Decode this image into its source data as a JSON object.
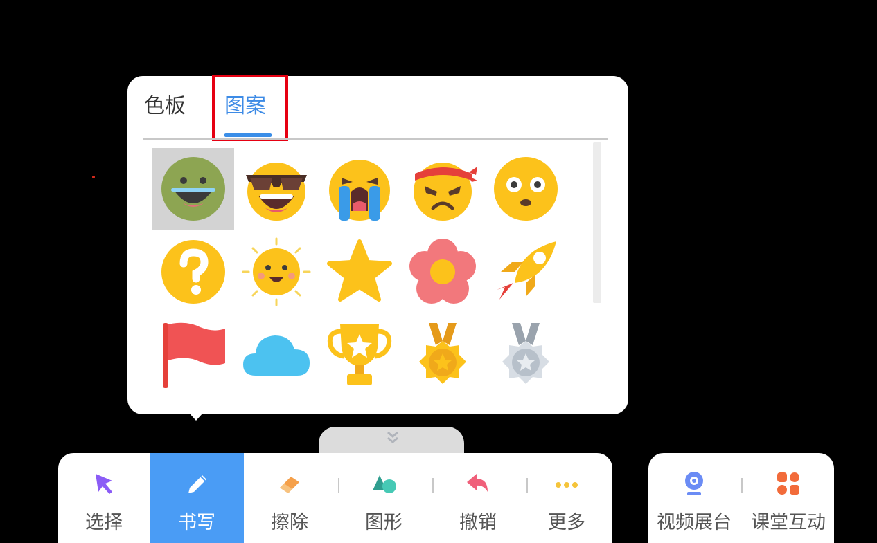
{
  "popup": {
    "tabs": [
      {
        "label": "色板",
        "active": false
      },
      {
        "label": "图案",
        "active": true
      }
    ],
    "patterns": [
      {
        "icon": "green-smile-face-icon",
        "selected": true
      },
      {
        "icon": "sunglasses-face-icon"
      },
      {
        "icon": "crying-face-icon"
      },
      {
        "icon": "angry-headband-face-icon"
      },
      {
        "icon": "surprised-face-icon"
      },
      {
        "icon": "question-mark-icon"
      },
      {
        "icon": "sun-icon"
      },
      {
        "icon": "star-icon"
      },
      {
        "icon": "flower-icon"
      },
      {
        "icon": "rocket-icon"
      },
      {
        "icon": "red-flag-icon"
      },
      {
        "icon": "cloud-icon"
      },
      {
        "icon": "trophy-icon"
      },
      {
        "icon": "gold-medal-icon"
      },
      {
        "icon": "silver-medal-icon"
      }
    ]
  },
  "toolbar": {
    "tools": [
      {
        "label": "选择",
        "icon": "cursor-icon"
      },
      {
        "label": "书写",
        "icon": "pen-icon",
        "active": true
      },
      {
        "label": "擦除",
        "icon": "eraser-icon"
      },
      {
        "label": "图形",
        "icon": "shapes-icon"
      },
      {
        "label": "撤销",
        "icon": "undo-icon"
      },
      {
        "label": "更多",
        "icon": "more-icon"
      }
    ]
  },
  "toolbar2": {
    "tools": [
      {
        "label": "视频展台",
        "icon": "webcam-icon"
      },
      {
        "label": "课堂互动",
        "icon": "interaction-icon"
      }
    ]
  },
  "colors": {
    "accent": "#4a9cf5",
    "tab_active": "#3d8be6",
    "highlight": "#e60012"
  }
}
